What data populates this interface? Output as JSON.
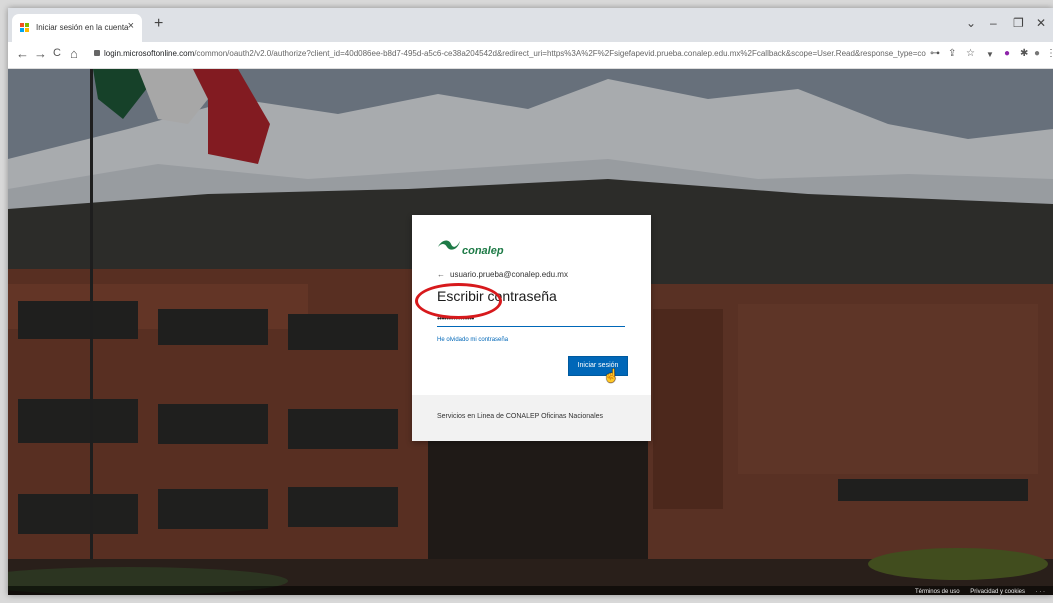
{
  "browser": {
    "tab_title": "Iniciar sesión en la cuenta",
    "tab_close": "×",
    "new_tab": "+",
    "url_host": "login.microsoftonline.com",
    "url_rest": "/common/oauth2/v2.0/authorize?client_id=40d086ee-b8d7-495d-a5c6-ce38a204542d&redirect_uri=https%3A%2F%2Fsigefapevid.prueba.conalep.edu.mx%2Fcallback&scope=User.Read&response_type=code&s...",
    "window_controls": {
      "dropdown": "⌄",
      "minimize": "–",
      "maximize": "❐",
      "close": "✕"
    },
    "nav": {
      "back": "←",
      "forward": "→",
      "reload": "C",
      "home": "⌂"
    },
    "toolbar_icons": {
      "key": "⊶",
      "share": "⇪",
      "star": "☆",
      "filter": "▼",
      "ext1": "●",
      "puzzle": "✱",
      "profile": "●",
      "menu": "⋮"
    }
  },
  "login": {
    "logo_text": "conalep",
    "back_arrow": "←",
    "email": "usuario.prueba@conalep.edu.mx",
    "heading": "Escribir contraseña",
    "password_value": "••••••••••••••••",
    "forgot_link": "He olvidado mi contraseña",
    "signin_button": "Iniciar sesión",
    "footer_text": "Servicios en Linea de CONALEP Oficinas Nacionales"
  },
  "page_footer": {
    "terms": "Términos de uso",
    "privacy": "Privacidad y cookies",
    "more": "· · ·"
  },
  "colors": {
    "accent": "#0067b8",
    "annotation": "#d7191c",
    "brand_green": "#1d7a46"
  }
}
